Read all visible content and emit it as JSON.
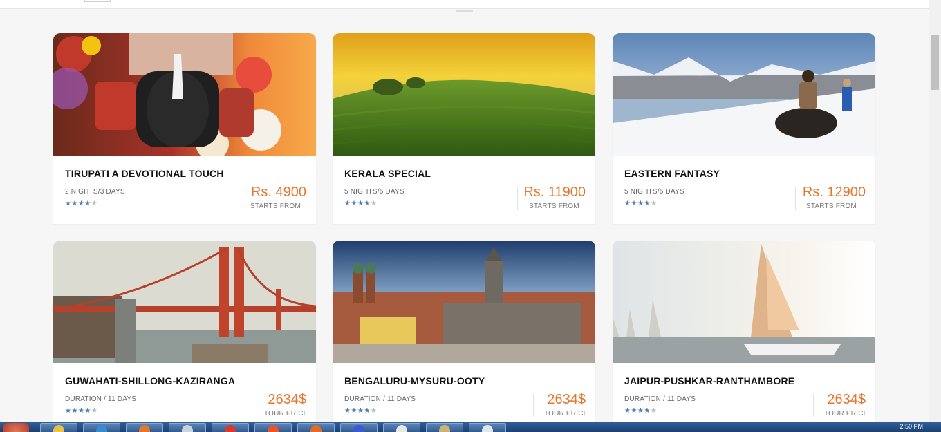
{
  "packages": [
    {
      "title": "TIRUPATI A DEVOTIONAL TOUCH",
      "duration": "2 NIGHTS/3 DAYS",
      "rating": 4,
      "price": "Rs. 4900",
      "price_label": "STARTS FROM",
      "image": "tirupati-deity-photo"
    },
    {
      "title": "KERALA SPECIAL",
      "duration": "5 NIGHTS/6 DAYS",
      "rating": 4,
      "price": "Rs. 11900",
      "price_label": "STARTS FROM",
      "image": "tea-plantation-photo"
    },
    {
      "title": "EASTERN FANTASY",
      "duration": "5 NIGHTS/6 DAYS",
      "rating": 4,
      "price": "Rs. 12900",
      "price_label": "STARTS FROM",
      "image": "snow-lake-yak-photo"
    },
    {
      "title": "GUWAHATI-SHILLONG-KAZIRANGA",
      "duration": "DURATION / 11 DAYS",
      "rating": 4,
      "price": "2634$",
      "price_label": "TOUR PRICE",
      "image": "golden-gate-bridge-photo"
    },
    {
      "title": "BENGALURU-MYSURU-OOTY",
      "duration": "DURATION / 11 DAYS",
      "rating": 4,
      "price": "2634$",
      "price_label": "TOUR PRICE",
      "image": "city-cathedral-photo"
    },
    {
      "title": "JAIPUR-PUSHKAR-RANTHAMBORE",
      "duration": "DURATION / 11 DAYS",
      "rating": 4,
      "price": "2634$",
      "price_label": "TOUR PRICE",
      "image": "sailboats-photo"
    }
  ],
  "colors": {
    "price": "#e8752d",
    "star_on": "#4b7db0",
    "star_off": "#b9b9b9"
  },
  "taskbar": {
    "clock": "2:50 PM"
  }
}
